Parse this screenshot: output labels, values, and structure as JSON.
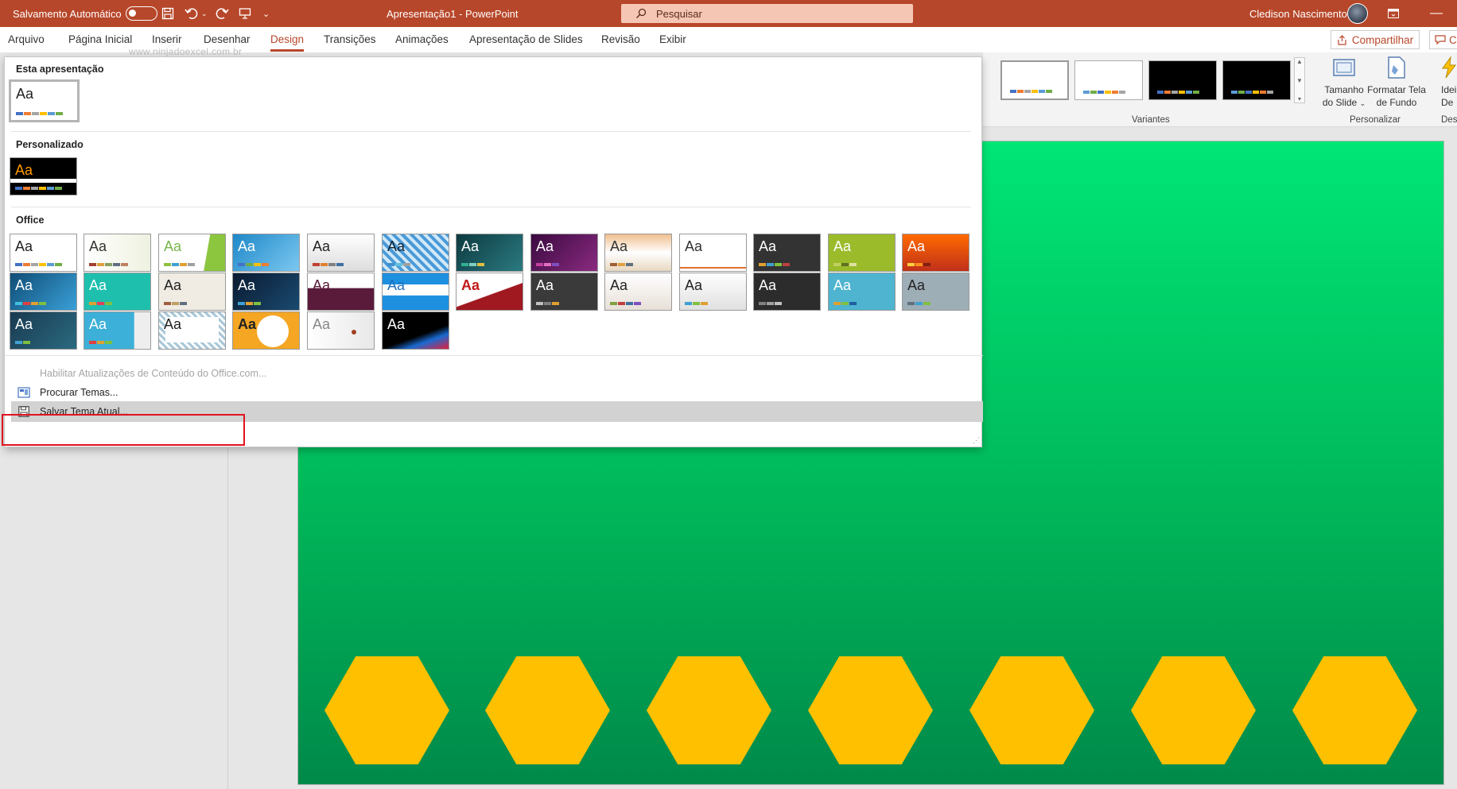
{
  "titlebar": {
    "autosave_label": "Salvamento Automático",
    "document_title": "Apresentação1  -  PowerPoint",
    "search_placeholder": "Pesquisar",
    "user_name": "Cledison Nascimento"
  },
  "menu": {
    "tabs": [
      "Arquivo",
      "Página Inicial",
      "Inserir",
      "Desenhar",
      "Design",
      "Transições",
      "Animações",
      "Apresentação de Slides",
      "Revisão",
      "Exibir"
    ],
    "active_tab": "Design",
    "share_label": "Compartilhar",
    "comments_label": "Co"
  },
  "watermark": "www.ninjadoexcel.com.br",
  "ribbon": {
    "variants_group": "Variantes",
    "personalizar_group": "Personalizar",
    "designer_group": "Des",
    "slide_size_label_1": "Tamanho",
    "slide_size_label_2": "do Slide",
    "format_bg_label_1": "Formatar Tela",
    "format_bg_label_2": "de Fundo",
    "ideas_label_1": "Idei",
    "ideas_label_2": "De"
  },
  "gallery": {
    "section_current": "Esta apresentação",
    "section_custom": "Personalizado",
    "section_office": "Office",
    "theme_sample": "Aa",
    "cmd_enable_updates": "Habilitar Atualizações de Conteúdo do Office.com...",
    "cmd_browse_themes": "Procurar Temas...",
    "cmd_save_theme": "Salvar Tema Atual..."
  },
  "colors": {
    "accent": "#b7472a",
    "slide_green": "#00c060",
    "hexagon": "#ffc000",
    "highlight_red": "#e0141e"
  }
}
